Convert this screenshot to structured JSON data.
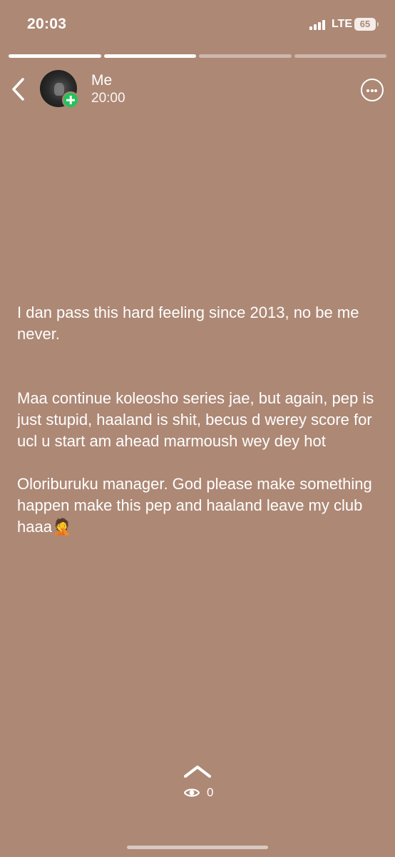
{
  "status_bar": {
    "time": "20:03",
    "network": "LTE",
    "battery": "65"
  },
  "progress": {
    "segments": [
      1,
      1,
      0,
      0
    ]
  },
  "header": {
    "name": "Me",
    "time": "20:00"
  },
  "post": {
    "paragraphs": [
      "I dan pass this hard feeling since 2013, no be me never.",
      "Maa continue koleosho series jae, but again, pep is just stupid, haaland is shit, becus d werey score for ucl u start am ahead marmoush wey dey hot",
      "Oloriburuku manager. God please make something happen make this pep and haaland leave my club haaa🤦"
    ]
  },
  "footer": {
    "view_count": "0"
  },
  "icons": {
    "back": "chevron-left-icon",
    "add": "plus-icon",
    "more": "ellipsis-circle-icon",
    "swipe": "chevron-up-icon",
    "views": "eye-icon"
  },
  "colors": {
    "background": "#ad8875",
    "add_badge": "#25c25a",
    "text": "#ffffff"
  }
}
